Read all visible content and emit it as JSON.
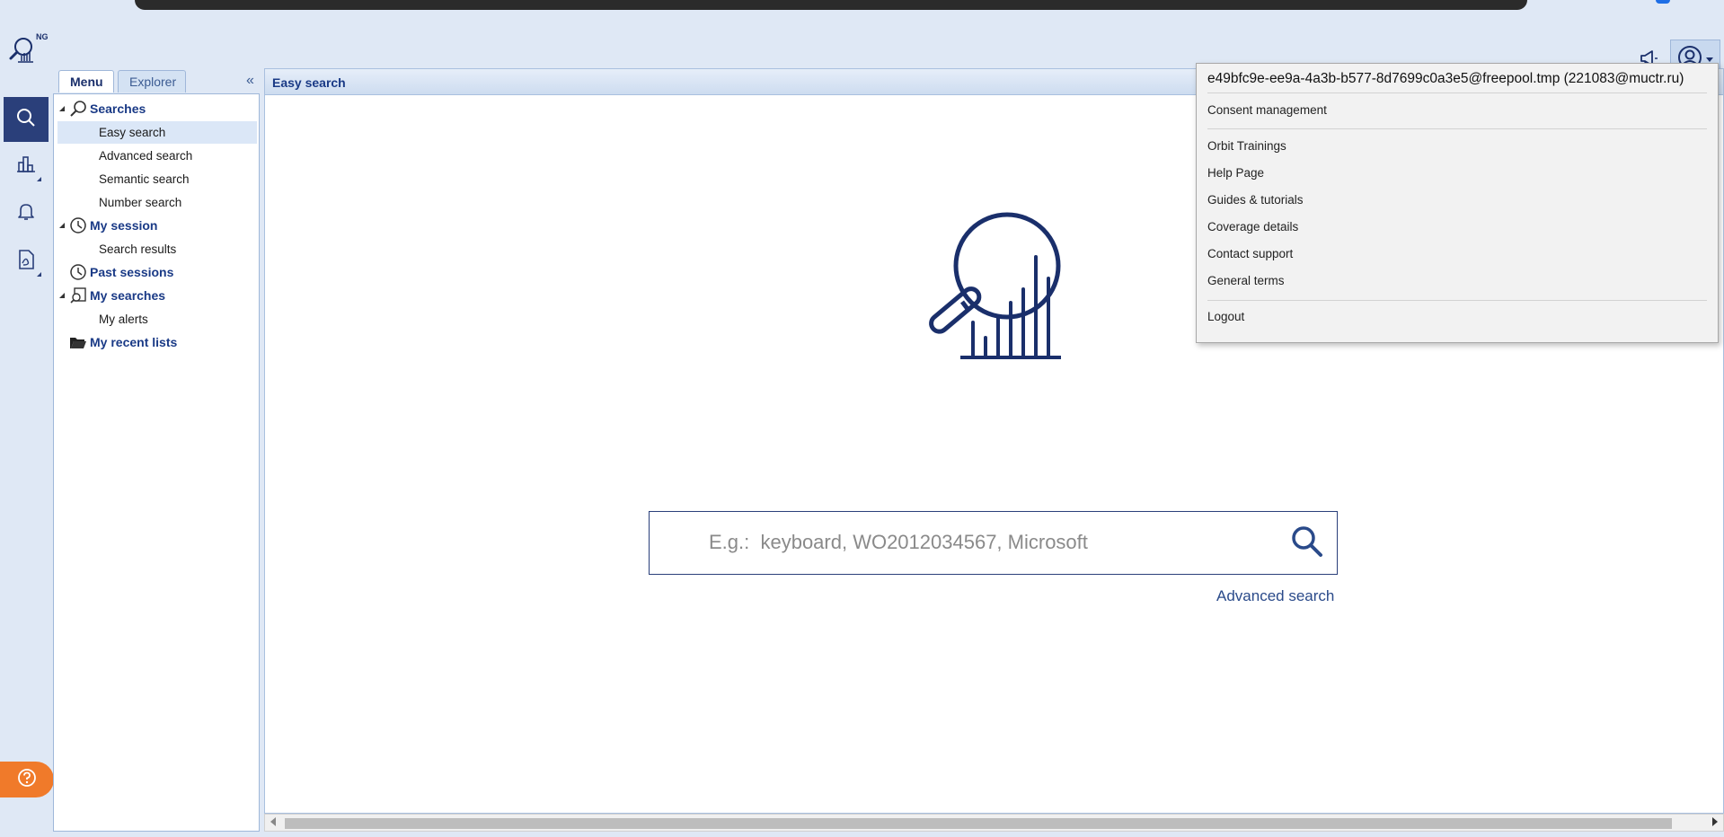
{
  "header": {
    "logo_text": "NG",
    "announce_icon": "megaphone-icon",
    "user_icon": "user-circle-icon"
  },
  "rail": {
    "items": [
      {
        "icon": "search-icon",
        "active": true
      },
      {
        "icon": "bar-chart-icon",
        "active": false
      },
      {
        "icon": "bell-icon",
        "active": false
      },
      {
        "icon": "pdf-document-icon",
        "active": false
      }
    ],
    "help_icon": "question-circle-icon"
  },
  "nav": {
    "tabs": [
      "Menu",
      "Explorer"
    ],
    "collapse_glyph": "«",
    "groups": {
      "searches": {
        "label": "Searches",
        "items": [
          "Easy search",
          "Advanced search",
          "Semantic search",
          "Number search"
        ]
      },
      "my_session": {
        "label": "My session",
        "items": [
          "Search results"
        ]
      },
      "past_sessions": {
        "label": "Past sessions"
      },
      "my_searches": {
        "label": "My searches",
        "items": [
          "My alerts"
        ]
      },
      "recent_lists": {
        "label": "My recent lists"
      }
    }
  },
  "main": {
    "title": "Easy search",
    "search": {
      "placeholder": "E.g.:  keyboard, WO2012034567, Microsoft"
    },
    "advanced_link": "Advanced search"
  },
  "user_menu": {
    "email": "e49bfc9e-ee9a-4a3b-b577-8d7699c0a3e5@freepool.tmp (221083@muctr.ru)",
    "consent": "Consent management",
    "help_items": [
      "Orbit Trainings",
      "Help Page",
      "Guides & tutorials",
      "Coverage details",
      "Contact support",
      "General terms"
    ],
    "logout": "Logout"
  },
  "colors": {
    "navy": "#1a3a86",
    "rail_active": "#2a3f7a",
    "help_orange": "#f07a2a",
    "background": "#dfe8f5"
  }
}
